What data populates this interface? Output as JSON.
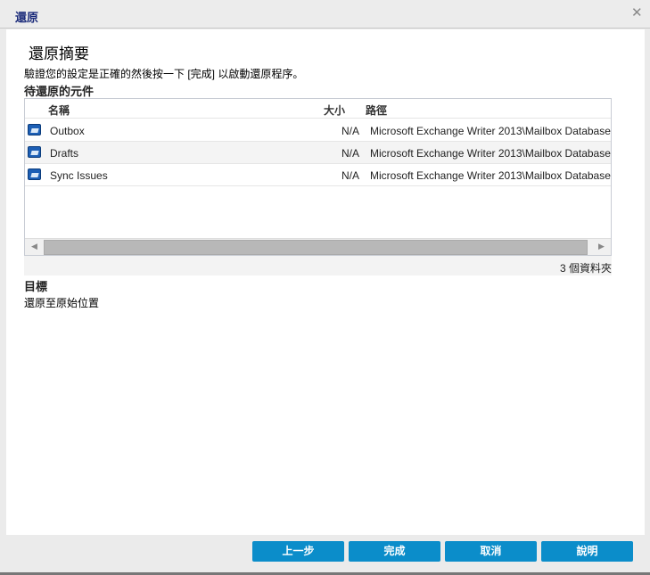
{
  "window": {
    "title": "還原",
    "close_icon": "close-icon"
  },
  "summary": {
    "heading": "還原摘要",
    "description": "驗證您的設定是正確的然後按一下 [完成] 以啟動還原程序。"
  },
  "items_section": {
    "label": "待還原的元件",
    "columns": {
      "name": "名稱",
      "size": "大小",
      "path": "路徑"
    },
    "rows": [
      {
        "name": "Outbox",
        "size": "N/A",
        "path": "Microsoft Exchange Writer 2013\\Mailbox Database"
      },
      {
        "name": "Drafts",
        "size": "N/A",
        "path": "Microsoft Exchange Writer 2013\\Mailbox Database"
      },
      {
        "name": "Sync Issues",
        "size": "N/A",
        "path": "Microsoft Exchange Writer 2013\\Mailbox Database"
      }
    ],
    "count_text": "3 個資料夾"
  },
  "target_section": {
    "label": "目標",
    "value": "還原至原始位置"
  },
  "buttons": {
    "back": "上一步",
    "finish": "完成",
    "cancel": "取消",
    "help": "說明"
  },
  "colors": {
    "accent": "#0b8dca",
    "title": "#1a2a7a"
  }
}
